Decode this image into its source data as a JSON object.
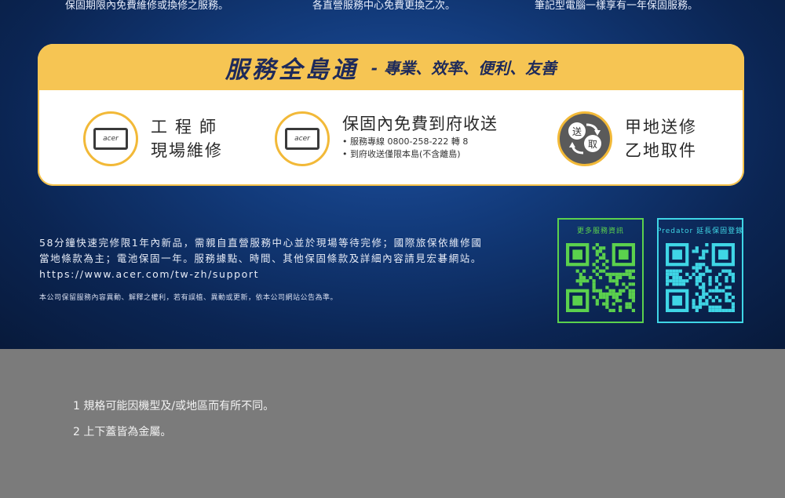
{
  "top_strip": {
    "left": "保固期限內免費維修或換修之服務。",
    "center": "各直營服務中心免費更換乙次。",
    "right": "筆記型電腦一樣享有一年保固服務。"
  },
  "banner": {
    "title": "服務全島通",
    "dash": "-",
    "subtitle": "專業、效率、便利、友善"
  },
  "features": {
    "engineer": {
      "line1": "工程師",
      "line2": "現場維修",
      "logo": "acer"
    },
    "delivery": {
      "title": "保固內免費到府收送",
      "bullet1": "服務專線 0800-258-222 轉 8",
      "bullet2": "到府收送僅限本島(不含離島)",
      "logo": "acer"
    },
    "pickup": {
      "line1": "甲地送修",
      "line2": "乙地取件",
      "send": "送",
      "take": "取"
    }
  },
  "info": {
    "line1": "58分鐘快速完修限1年內新品，需親自直營服務中心並於現場等待完修；國際旅保依維修國",
    "line2": "當地條款為主；電池保固一年。服務據點、時間、其他保固條款及詳細內容請見宏碁網站。",
    "url": "https://www.acer.com/tw-zh/support",
    "notice": "本公司保留服務內容異動、解釋之權利，若有誤植、異動或更新，依本公司網站公告為準。"
  },
  "qr": {
    "left_label": "更多服務資訊",
    "right_label": "Predator 延長保固登錄",
    "left_color": "#5bd14d",
    "right_color": "#3fd6e6"
  },
  "footnotes": {
    "n1": "1 規格可能因機型及/或地區而有所不同。",
    "n2": "2 上下蓋皆為金屬。"
  }
}
